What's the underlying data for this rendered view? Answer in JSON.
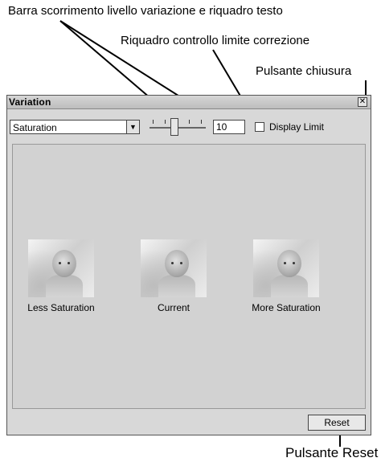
{
  "callouts": {
    "slider_and_textbox": "Barra scorrimento livello variazione e riquadro testo",
    "limit_checkbox": "Riquadro controllo limite correzione",
    "close_button": "Pulsante chiusura",
    "reset_button": "Pulsante Reset"
  },
  "window": {
    "title": "Variation",
    "close_glyph": "✕"
  },
  "controls": {
    "variation_select_value": "Saturation",
    "dropdown_glyph": "▼",
    "level_value": "10",
    "display_limit_label": "Display Limit",
    "display_limit_checked": false
  },
  "thumbnails": [
    {
      "label": "Less Saturation"
    },
    {
      "label": "Current"
    },
    {
      "label": "More Saturation"
    }
  ],
  "buttons": {
    "reset_label": "Reset"
  },
  "icons": {
    "close": "close-icon",
    "dropdown": "chevron-down-icon"
  }
}
